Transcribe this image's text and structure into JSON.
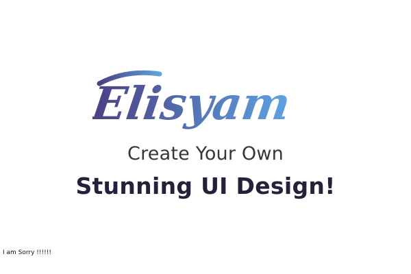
{
  "brand": {
    "logo_text": "Elisyam",
    "gradient_start": "#4a3f83",
    "gradient_end": "#5ea3e2"
  },
  "hero": {
    "subtitle": "Create Your Own",
    "title": "Stunning UI Design!"
  },
  "footer": {
    "note": "I am Sorry !!!!!!"
  }
}
